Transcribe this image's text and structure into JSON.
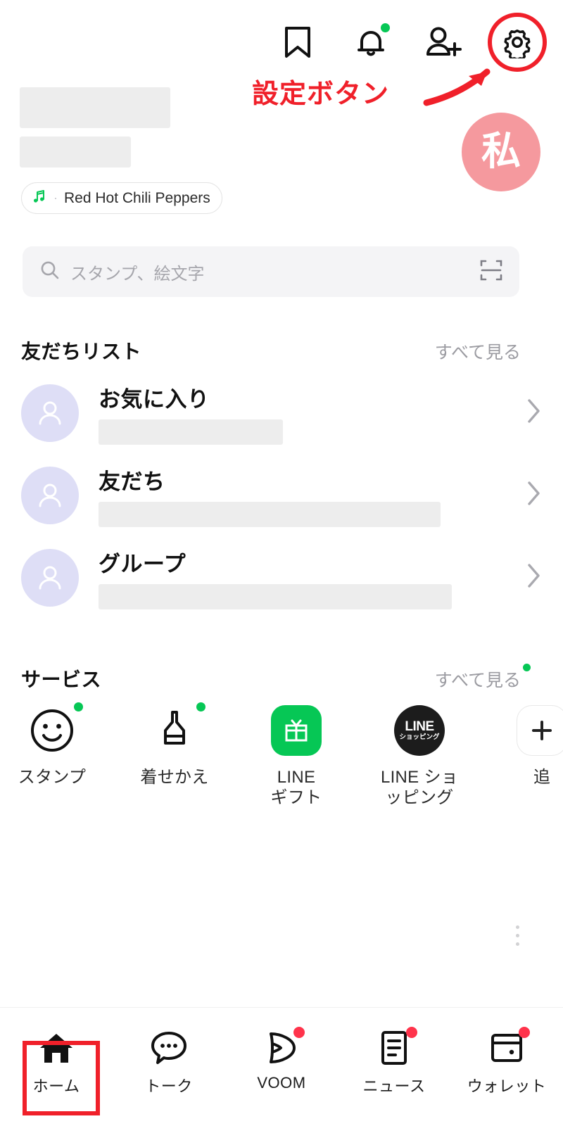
{
  "app": {
    "name": "LINE",
    "screen": "ホーム",
    "accent_green": "#06C755",
    "annotation_red": "#F0202A",
    "avatar_pink": "#F5999E"
  },
  "topbar": {
    "icons": [
      {
        "name": "bookmark-icon",
        "label": "ブックマーク",
        "badge": false
      },
      {
        "name": "bell-icon",
        "label": "お知らせ",
        "badge": true
      },
      {
        "name": "add-friend-icon",
        "label": "友だち追加",
        "badge": false
      },
      {
        "name": "gear-icon",
        "label": "設定",
        "badge": false,
        "highlighted": true
      }
    ]
  },
  "annotation": {
    "text": "設定ボタン",
    "color": "#F0202A",
    "target": "gear-icon"
  },
  "profile": {
    "display_name_redacted": true,
    "status_message_redacted": true,
    "avatar_text": "私",
    "music": {
      "icon": "music-note-icon",
      "title": "Red Hot Chili Peppers"
    }
  },
  "search": {
    "icon": "search-icon",
    "placeholder": "スタンプ、絵文字",
    "scan_icon": "qr-scan-icon"
  },
  "friends": {
    "title": "友だちリスト",
    "see_all": "すべて見る",
    "rows": [
      {
        "label": "お気に入り",
        "icon": "person-avatar-icon",
        "count_redacted": true,
        "chevron": "chevron-right-icon"
      },
      {
        "label": "友だち",
        "icon": "person-avatar-icon",
        "count_redacted": true,
        "chevron": "chevron-right-icon"
      },
      {
        "label": "グループ",
        "icon": "person-avatar-icon",
        "count_redacted": true,
        "chevron": "chevron-right-icon"
      }
    ]
  },
  "services": {
    "title": "サービス",
    "see_all": "すべて見る",
    "see_all_badge": true,
    "items": [
      {
        "label": "スタンプ",
        "icon": "smiley-face-icon",
        "badge": true
      },
      {
        "label": "着せかえ",
        "icon": "brush-icon",
        "badge": true
      },
      {
        "label": "LINE\nギフト",
        "label_line1": "LINE",
        "label_line2": "ギフト",
        "icon": "gift-icon",
        "badge": false
      },
      {
        "label": "LINE ショッピング",
        "label_line1": "LINE ショ",
        "label_line2": "ッピング",
        "icon": "line-shopping-icon",
        "badge": false,
        "badge_text_1": "LINE",
        "badge_text_2": "ショッピング"
      },
      {
        "label": "追加",
        "label_line1": "追",
        "icon": "plus-icon",
        "badge": false
      }
    ]
  },
  "bottom_nav": {
    "active": "ホーム",
    "items": [
      {
        "label": "ホーム",
        "icon": "home-icon",
        "badge": false,
        "active": true
      },
      {
        "label": "トーク",
        "icon": "chat-bubble-icon",
        "badge": false,
        "active": false
      },
      {
        "label": "VOOM",
        "icon": "voom-play-icon",
        "badge": true,
        "active": false
      },
      {
        "label": "ニュース",
        "icon": "news-icon",
        "badge": true,
        "active": false
      },
      {
        "label": "ウォレット",
        "icon": "wallet-icon",
        "badge": true,
        "active": false
      }
    ]
  }
}
